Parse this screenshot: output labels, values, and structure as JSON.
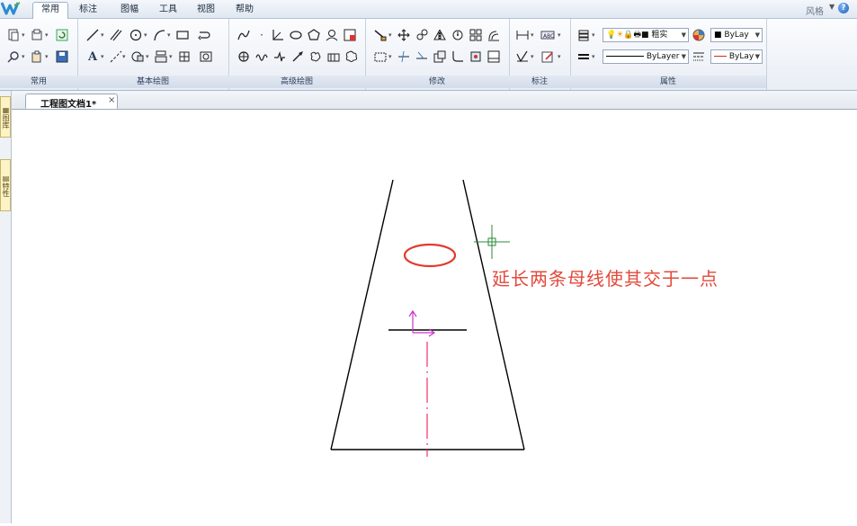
{
  "menubar": {
    "tabs": [
      {
        "label": "常用",
        "active": true
      },
      {
        "label": "标注",
        "active": false
      },
      {
        "label": "图幅",
        "active": false
      },
      {
        "label": "工具",
        "active": false
      },
      {
        "label": "视图",
        "active": false
      },
      {
        "label": "帮助",
        "active": false
      }
    ],
    "style_label": "风格"
  },
  "ribbon": {
    "groups": [
      "常用",
      "基本绘图",
      "高级绘图",
      "修改",
      "标注",
      "属性"
    ],
    "properties": {
      "line_weight_label": "粗实",
      "color_combo": "ByLay",
      "linetype_combo": "ByLayer",
      "line_color_combo": "ByLay"
    }
  },
  "document": {
    "tab_title": "工程图文档1*",
    "close_glyph": "×"
  },
  "sidepanel": {
    "tabs": [
      "图库",
      "特性"
    ]
  },
  "canvas": {
    "annotation": "延长两条母线使其交于一点",
    "colors": {
      "lines": "#000000",
      "ellipse": "#e33a2e",
      "centerline": "#ee3366",
      "ucs": "#cc33cc",
      "crosshair": "#2a8a3a",
      "annotation": "#e24a3c"
    }
  }
}
